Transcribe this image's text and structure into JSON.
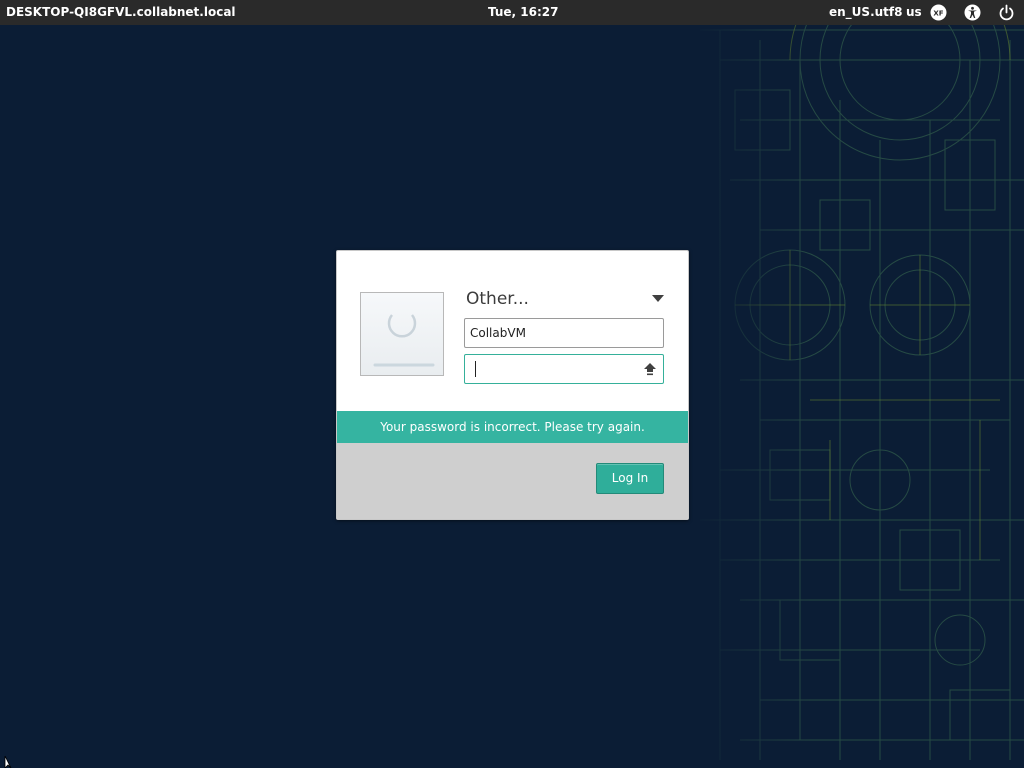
{
  "top_panel": {
    "hostname": "DESKTOP-QI8GFVL.collabnet.local",
    "clock": "Tue, 16:27",
    "locale": "en_US.utf8",
    "keyboard_layout": "us",
    "icons": [
      "xf-icon",
      "accessibility-icon",
      "power-icon"
    ]
  },
  "login": {
    "user_selector": "Other...",
    "username_value": "CollabVM",
    "password_value": "",
    "error_message": "Your password is incorrect. Please try again.",
    "login_button": "Log In",
    "icons": [
      "avatar-placeholder-icon",
      "chevron-down-icon",
      "capslock-icon"
    ]
  },
  "colors": {
    "panel_bg": "#2a2a2a",
    "desktop_bg": "#0b1d35",
    "accent": "#35b4a1",
    "footer_bg": "#cfcfcf"
  }
}
